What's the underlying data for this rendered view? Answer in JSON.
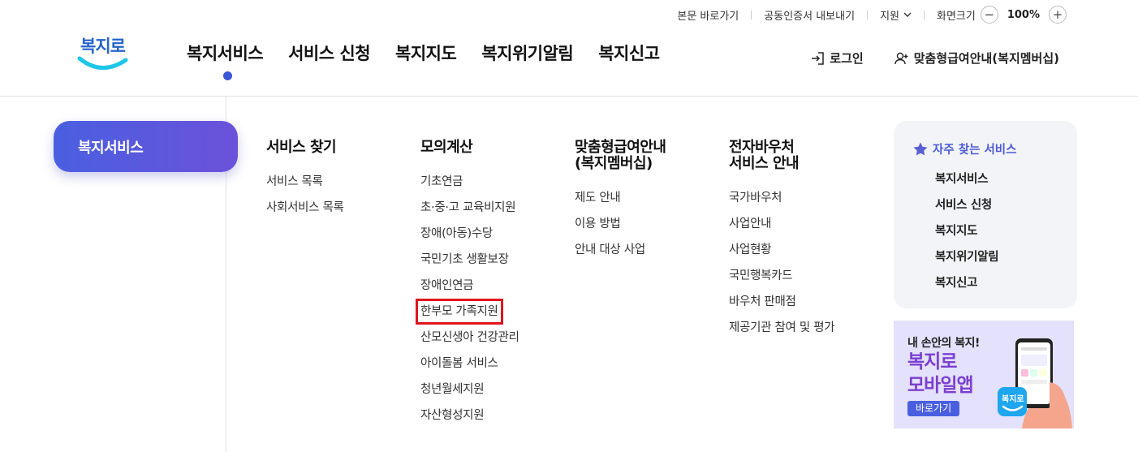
{
  "utility": {
    "skip_link": "본문 바로가기",
    "cert_export": "공동인증서 내보내기",
    "region": "지원",
    "screen_size": "화면크기",
    "zoom_value": "100%"
  },
  "logo": {
    "text": "복지로"
  },
  "gnb": [
    "복지서비스",
    "서비스 신청",
    "복지지도",
    "복지위기알림",
    "복지신고"
  ],
  "header_right": {
    "login": "로그인",
    "membership": "맞춤형급여안내(복지멤버십)"
  },
  "side_title": "복지서비스",
  "columns": [
    {
      "title": "서비스 찾기",
      "items": [
        "서비스 목록",
        "사회서비스 목록"
      ]
    },
    {
      "title": "모의계산",
      "items": [
        "기초연금",
        "초·중·고 교육비지원",
        "장애(아동)수당",
        "국민기초 생활보장",
        "장애인연금",
        "한부모 가족지원",
        "산모신생아 건강관리",
        "아이돌봄 서비스",
        "청년월세지원",
        "자산형성지원"
      ]
    },
    {
      "title": "맞춤형급여안내\n(복지멤버십)",
      "items": [
        "제도 안내",
        "이용 방법",
        "안내 대상 사업"
      ]
    },
    {
      "title": "전자바우처\n서비스 안내",
      "items": [
        "국가바우처",
        "사업안내",
        "사업현황",
        "국민행복카드",
        "바우처 판매점",
        "제공기관 참여 및 평가"
      ]
    }
  ],
  "favorites": {
    "title": "자주 찾는 서비스",
    "items": [
      "복지서비스",
      "서비스 신청",
      "복지지도",
      "복지위기알림",
      "복지신고"
    ]
  },
  "banner": {
    "line1": "내 손안의 복지!",
    "line2": "복지로\n모바일앱",
    "button": "바로가기"
  },
  "colors": {
    "accent": "#3b57d6",
    "highlight": "#e0141e",
    "banner_text": "#7b3fd0"
  }
}
